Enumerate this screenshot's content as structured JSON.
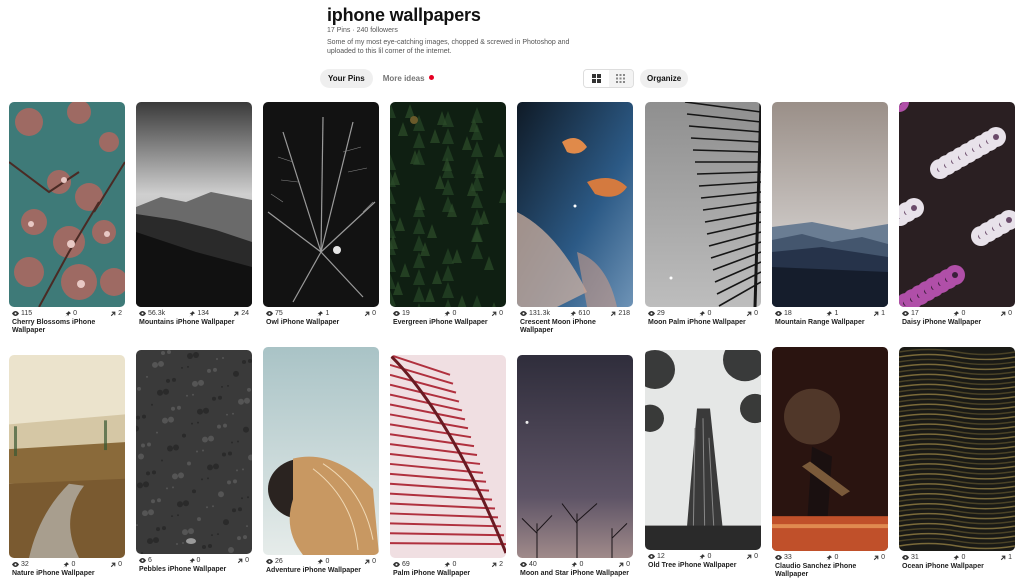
{
  "board": {
    "title": "iphone wallpapers",
    "meta": "17 Pins · 240 followers",
    "description": "Some of my most eye-catching images, chopped & screwed in Photoshop and uploaded to this lil corner of the internet."
  },
  "tabs": {
    "your_pins": "Your Pins",
    "more_ideas": "More ideas"
  },
  "toolbar": {
    "organize": "Organize",
    "view_default_icon": "grid-default-icon",
    "view_compact_icon": "grid-compact-icon"
  },
  "pins": [
    {
      "title": "Cherry Blossoms iPhone Wallpaper",
      "views": "115",
      "saves": "0",
      "clicks": "2"
    },
    {
      "title": "Mountains iPhone Wallpaper",
      "views": "56.3k",
      "saves": "134",
      "clicks": "24"
    },
    {
      "title": "Owl iPhone Wallpaper",
      "views": "75",
      "saves": "1",
      "clicks": "0"
    },
    {
      "title": "Evergreen iPhone Wallpaper",
      "views": "19",
      "saves": "0",
      "clicks": "0"
    },
    {
      "title": "Crescent Moon iPhone Wallpaper",
      "views": "131.3k",
      "saves": "610",
      "clicks": "218"
    },
    {
      "title": "Moon Palm iPhone Wallpaper",
      "views": "29",
      "saves": "0",
      "clicks": "0"
    },
    {
      "title": "Mountain Range Wallpaper",
      "views": "18",
      "saves": "1",
      "clicks": "1"
    },
    {
      "title": "Daisy iPhone Wallpaper",
      "views": "17",
      "saves": "0",
      "clicks": "0"
    },
    {
      "title": "Nature iPhone Wallpaper",
      "views": "32",
      "saves": "0",
      "clicks": "0"
    },
    {
      "title": "Pebbles iPhone Wallpaper",
      "views": "6",
      "saves": "0",
      "clicks": "0"
    },
    {
      "title": "Adventure iPhone Wallpaper",
      "views": "26",
      "saves": "0",
      "clicks": "0"
    },
    {
      "title": "Palm iPhone Wallpaper",
      "views": "69",
      "saves": "0",
      "clicks": "2"
    },
    {
      "title": "Moon and Star iPhone Wallpaper",
      "views": "40",
      "saves": "0",
      "clicks": "0"
    },
    {
      "title": "Old Tree iPhone Wallpaper",
      "views": "12",
      "saves": "0",
      "clicks": "0"
    },
    {
      "title": "Claudio Sanchez iPhone Wallpaper",
      "views": "33",
      "saves": "0",
      "clicks": "0"
    },
    {
      "title": "Ocean iPhone Wallpaper",
      "views": "31",
      "saves": "0",
      "clicks": "1"
    }
  ],
  "colors": {
    "accent_red": "#e60023",
    "button_gray": "#efefef"
  }
}
